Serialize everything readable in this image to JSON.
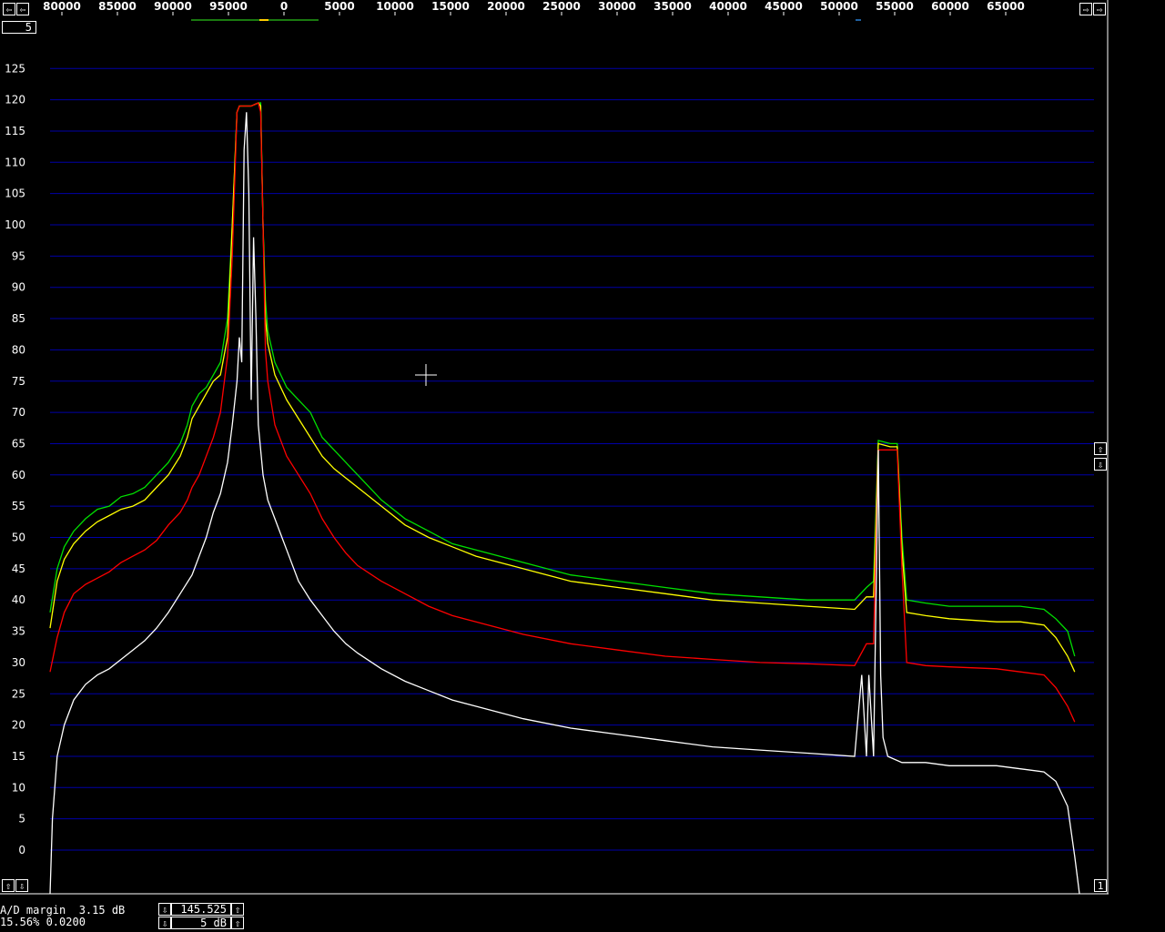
{
  "chart_data": {
    "type": "line",
    "x_tick_labels": [
      "80000",
      "85000",
      "90000",
      "95000",
      "0",
      "5000",
      "10000",
      "15000",
      "20000",
      "25000",
      "30000",
      "35000",
      "40000",
      "45000",
      "50000",
      "55000",
      "60000",
      "65000"
    ],
    "y_ticks": [
      0,
      5,
      10,
      15,
      20,
      25,
      30,
      35,
      40,
      45,
      50,
      55,
      60,
      65,
      70,
      75,
      80,
      85,
      90,
      95,
      100,
      105,
      110,
      115,
      120,
      125
    ],
    "ylim": [
      -3,
      128
    ],
    "grid": true,
    "series": [
      {
        "color": "#00e000",
        "points": [
          [
            0,
            38
          ],
          [
            3,
            45
          ],
          [
            6,
            48.5
          ],
          [
            10,
            51
          ],
          [
            15,
            53
          ],
          [
            20,
            54.5
          ],
          [
            25,
            55
          ],
          [
            30,
            56.5
          ],
          [
            35,
            57
          ],
          [
            40,
            58
          ],
          [
            45,
            60
          ],
          [
            50,
            62
          ],
          [
            55,
            65
          ],
          [
            58,
            68
          ],
          [
            60,
            71
          ],
          [
            63,
            73
          ],
          [
            66,
            74
          ],
          [
            69,
            76
          ],
          [
            72,
            78
          ],
          [
            75,
            85
          ],
          [
            77,
            100
          ],
          [
            79,
            118
          ],
          [
            80,
            119
          ],
          [
            85,
            119
          ],
          [
            88,
            119.5
          ],
          [
            89,
            119.5
          ],
          [
            90,
            100
          ],
          [
            91,
            88
          ],
          [
            92,
            83
          ],
          [
            95,
            78
          ],
          [
            100,
            74
          ],
          [
            105,
            72
          ],
          [
            110,
            70
          ],
          [
            115,
            66
          ],
          [
            120,
            64
          ],
          [
            125,
            62
          ],
          [
            130,
            60
          ],
          [
            140,
            56
          ],
          [
            150,
            53
          ],
          [
            160,
            51
          ],
          [
            170,
            49
          ],
          [
            180,
            48
          ],
          [
            190,
            47
          ],
          [
            200,
            46
          ],
          [
            220,
            44
          ],
          [
            240,
            43
          ],
          [
            260,
            42
          ],
          [
            280,
            41
          ],
          [
            300,
            40.5
          ],
          [
            320,
            40
          ],
          [
            340,
            40
          ],
          [
            345,
            42
          ],
          [
            348,
            43
          ],
          [
            350,
            65.5
          ],
          [
            355,
            65
          ],
          [
            358,
            65
          ],
          [
            360,
            50
          ],
          [
            362,
            40
          ],
          [
            370,
            39.5
          ],
          [
            380,
            39
          ],
          [
            400,
            39
          ],
          [
            410,
            39
          ],
          [
            420,
            38.5
          ],
          [
            425,
            37
          ],
          [
            430,
            35
          ],
          [
            433,
            31
          ]
        ]
      },
      {
        "color": "#ffff00",
        "points": [
          [
            0,
            35.5
          ],
          [
            3,
            43
          ],
          [
            6,
            46.5
          ],
          [
            10,
            49
          ],
          [
            15,
            51
          ],
          [
            20,
            52.5
          ],
          [
            25,
            53.5
          ],
          [
            30,
            54.5
          ],
          [
            35,
            55
          ],
          [
            40,
            56
          ],
          [
            45,
            58
          ],
          [
            50,
            60
          ],
          [
            55,
            63
          ],
          [
            58,
            66
          ],
          [
            60,
            69
          ],
          [
            63,
            71
          ],
          [
            66,
            73
          ],
          [
            69,
            75
          ],
          [
            72,
            76
          ],
          [
            75,
            82
          ],
          [
            77,
            100
          ],
          [
            79,
            118
          ],
          [
            80,
            119
          ],
          [
            85,
            119
          ],
          [
            88,
            119.5
          ],
          [
            89,
            119
          ],
          [
            90,
            100
          ],
          [
            91,
            85
          ],
          [
            92,
            81
          ],
          [
            95,
            76
          ],
          [
            100,
            72
          ],
          [
            105,
            69
          ],
          [
            110,
            66
          ],
          [
            115,
            63
          ],
          [
            120,
            61
          ],
          [
            125,
            59.5
          ],
          [
            130,
            58
          ],
          [
            140,
            55
          ],
          [
            150,
            52
          ],
          [
            160,
            50
          ],
          [
            170,
            48.5
          ],
          [
            180,
            47
          ],
          [
            190,
            46
          ],
          [
            200,
            45
          ],
          [
            220,
            43
          ],
          [
            240,
            42
          ],
          [
            260,
            41
          ],
          [
            280,
            40
          ],
          [
            300,
            39.5
          ],
          [
            320,
            39
          ],
          [
            340,
            38.5
          ],
          [
            345,
            40.5
          ],
          [
            348,
            40.5
          ],
          [
            350,
            65
          ],
          [
            355,
            64.5
          ],
          [
            358,
            64.5
          ],
          [
            360,
            48
          ],
          [
            362,
            38
          ],
          [
            370,
            37.5
          ],
          [
            380,
            37
          ],
          [
            400,
            36.5
          ],
          [
            410,
            36.5
          ],
          [
            420,
            36
          ],
          [
            425,
            34
          ],
          [
            430,
            31
          ],
          [
            433,
            28.5
          ]
        ]
      },
      {
        "color": "#ff0000",
        "points": [
          [
            0,
            28.5
          ],
          [
            3,
            34
          ],
          [
            6,
            38
          ],
          [
            10,
            41
          ],
          [
            15,
            42.5
          ],
          [
            20,
            43.5
          ],
          [
            25,
            44.5
          ],
          [
            30,
            46
          ],
          [
            35,
            47
          ],
          [
            40,
            48
          ],
          [
            45,
            49.5
          ],
          [
            50,
            52
          ],
          [
            55,
            54
          ],
          [
            58,
            56
          ],
          [
            60,
            58
          ],
          [
            63,
            60
          ],
          [
            66,
            63
          ],
          [
            69,
            66
          ],
          [
            72,
            70
          ],
          [
            75,
            79
          ],
          [
            77,
            95
          ],
          [
            79,
            118
          ],
          [
            80,
            119
          ],
          [
            85,
            119
          ],
          [
            88,
            119.5
          ],
          [
            89,
            118
          ],
          [
            90,
            100
          ],
          [
            91,
            80
          ],
          [
            92,
            75
          ],
          [
            95,
            68
          ],
          [
            100,
            63
          ],
          [
            105,
            60
          ],
          [
            110,
            57
          ],
          [
            115,
            53
          ],
          [
            120,
            50
          ],
          [
            125,
            47.5
          ],
          [
            130,
            45.5
          ],
          [
            140,
            43
          ],
          [
            150,
            41
          ],
          [
            160,
            39
          ],
          [
            170,
            37.5
          ],
          [
            180,
            36.5
          ],
          [
            190,
            35.5
          ],
          [
            200,
            34.5
          ],
          [
            220,
            33
          ],
          [
            240,
            32
          ],
          [
            260,
            31
          ],
          [
            280,
            30.5
          ],
          [
            300,
            30
          ],
          [
            320,
            29.8
          ],
          [
            340,
            29.5
          ],
          [
            345,
            33
          ],
          [
            348,
            33
          ],
          [
            350,
            64
          ],
          [
            355,
            64
          ],
          [
            358,
            64
          ],
          [
            360,
            45
          ],
          [
            362,
            30
          ],
          [
            370,
            29.5
          ],
          [
            380,
            29.3
          ],
          [
            400,
            29
          ],
          [
            410,
            28.5
          ],
          [
            420,
            28
          ],
          [
            425,
            26
          ],
          [
            430,
            23
          ],
          [
            433,
            20.5
          ]
        ]
      },
      {
        "color": "#ffffff",
        "points": [
          [
            0,
            -10
          ],
          [
            1,
            5
          ],
          [
            3,
            15
          ],
          [
            6,
            20
          ],
          [
            10,
            24
          ],
          [
            15,
            26.5
          ],
          [
            20,
            28
          ],
          [
            25,
            29
          ],
          [
            30,
            30.5
          ],
          [
            35,
            32
          ],
          [
            40,
            33.5
          ],
          [
            45,
            35.5
          ],
          [
            50,
            38
          ],
          [
            55,
            41
          ],
          [
            60,
            44
          ],
          [
            63,
            47
          ],
          [
            66,
            50
          ],
          [
            69,
            54
          ],
          [
            72,
            57
          ],
          [
            75,
            62
          ],
          [
            77,
            68
          ],
          [
            79,
            75
          ],
          [
            80,
            82
          ],
          [
            81,
            78
          ],
          [
            82,
            112
          ],
          [
            83,
            118
          ],
          [
            84,
            105
          ],
          [
            85,
            72
          ],
          [
            86,
            98
          ],
          [
            87,
            85
          ],
          [
            88,
            68
          ],
          [
            90,
            60
          ],
          [
            92,
            56
          ],
          [
            95,
            53
          ],
          [
            98,
            50
          ],
          [
            100,
            48
          ],
          [
            105,
            43
          ],
          [
            110,
            40
          ],
          [
            115,
            37.5
          ],
          [
            120,
            35
          ],
          [
            125,
            33
          ],
          [
            130,
            31.5
          ],
          [
            140,
            29
          ],
          [
            150,
            27
          ],
          [
            160,
            25.5
          ],
          [
            170,
            24
          ],
          [
            180,
            23
          ],
          [
            190,
            22
          ],
          [
            200,
            21
          ],
          [
            220,
            19.5
          ],
          [
            240,
            18.5
          ],
          [
            260,
            17.5
          ],
          [
            280,
            16.5
          ],
          [
            300,
            16
          ],
          [
            320,
            15.5
          ],
          [
            340,
            15
          ],
          [
            343,
            28
          ],
          [
            345,
            15
          ],
          [
            346,
            28
          ],
          [
            348,
            15
          ],
          [
            350,
            64
          ],
          [
            351,
            28
          ],
          [
            352,
            18
          ],
          [
            354,
            15
          ],
          [
            360,
            14
          ],
          [
            370,
            14
          ],
          [
            380,
            13.5
          ],
          [
            400,
            13.5
          ],
          [
            410,
            13
          ],
          [
            420,
            12.5
          ],
          [
            425,
            11
          ],
          [
            430,
            7
          ],
          [
            433,
            -1
          ],
          [
            435,
            -10
          ]
        ]
      }
    ]
  },
  "header": {
    "left_arrow": "⇦",
    "right_arrow": "⇨",
    "field_value": "5"
  },
  "side_buttons": {
    "up": "⇧",
    "down": "⇩",
    "corner_value": "1"
  },
  "status": {
    "ad_margin": "A/D margin  3.15 dB",
    "stats": "15.56% 0.0200",
    "freq_value": "145.525",
    "db_step": "5 dB"
  },
  "colors": {
    "grid": "#0000a8",
    "background": "#000000"
  }
}
